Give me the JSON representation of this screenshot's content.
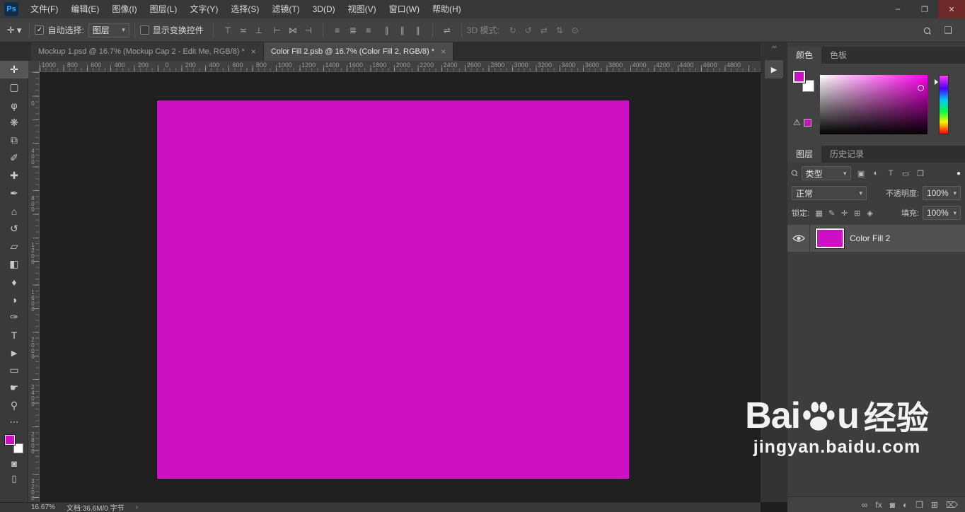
{
  "colors": {
    "accent": "#CB11C3",
    "hue": "#FF00EA"
  },
  "icons": {
    "ps-logo": "Ps",
    "minimize-window": "–",
    "restore-window": "❐",
    "close-window": "✕",
    "caret-down": "▾",
    "check": "✓",
    "search": "Ϙ",
    "tab-close": "×",
    "move-tool": "✛",
    "rectangular-marquee-tool": "▢",
    "lasso-tool": "φ",
    "quick-selection-tool": "❋",
    "crop-tool": "⧉",
    "eyedropper-tool": "✐",
    "spot-healing-brush-tool": "✚",
    "brush-tool": "✒",
    "clone-stamp-tool": "⌂",
    "history-brush-tool": "↺",
    "eraser-tool": "▱",
    "gradient-tool": "◧",
    "blur-tool": "♦",
    "dodge-tool": "◑",
    "pen-tool": "✑",
    "horizontal-type-tool": "T",
    "path-selection-tool": "►",
    "rectangle-tool": "▭",
    "hand-tool": "☛",
    "zoom-tool": "⚲",
    "edit-toolbar": "⋯",
    "quick-mask": "◙",
    "screen-mode": "▯",
    "align-top-edges": "⊤",
    "align-vertical-centers": "≍",
    "align-bottom-edges": "⊥",
    "align-left-edges": "⊢",
    "align-horizontal-centers": "⋈",
    "align-right-edges": "⊣",
    "distribute-top-edges": "≡",
    "distribute-vertical-centers": "≣",
    "distribute-bottom-edges": "≡",
    "distribute-left-edges": "∥",
    "distribute-horizontal-centers": "∥",
    "distribute-right-edges": "∥",
    "distribute-spacing": "⇌",
    "orbit-3d-camera": "↻",
    "roll-3d-camera": "↺",
    "pan-3d-camera": "⇄",
    "slide-3d-camera": "⇅",
    "zoom-3d-camera": "⊙",
    "workspace-switcher": "❏",
    "panel-collapse": "^^",
    "panel-expand": "▶",
    "gamut-warning": "⚠",
    "filter-pixel-layers": "▣",
    "filter-adjustment-layers": "◐",
    "filter-type-layers": "T",
    "filter-shape-layers": "▭",
    "filter-smart-objects": "❒",
    "filter-toggle": "●",
    "lock-transparent-pixels": "▦",
    "lock-image-pixels": "✎",
    "lock-position": "✛",
    "lock-artboard": "⊞",
    "lock-all": "◈",
    "link-layers": "∞",
    "layer-style": "fx",
    "add-layer-mask": "◙",
    "new-adjustment-layer": "◐",
    "new-group": "❒",
    "new-layer": "⊞",
    "delete-layer": "⌦",
    "status-expand": "›"
  },
  "menubar": {
    "items": [
      {
        "label": "文件(F)"
      },
      {
        "label": "编辑(E)"
      },
      {
        "label": "图像(I)"
      },
      {
        "label": "图层(L)"
      },
      {
        "label": "文字(Y)"
      },
      {
        "label": "选择(S)"
      },
      {
        "label": "滤镜(T)"
      },
      {
        "label": "3D(D)"
      },
      {
        "label": "视图(V)"
      },
      {
        "label": "窗口(W)"
      },
      {
        "label": "帮助(H)"
      }
    ]
  },
  "optionsbar": {
    "auto_select_label": "自动选择:",
    "auto_select_value": "图层",
    "show_transform_label": "显示变换控件",
    "mode_3d_label": "3D 模式:",
    "align_icons_1": [
      "align-top-edges",
      "align-vertical-centers",
      "align-bottom-edges"
    ],
    "align_icons_2": [
      "align-left-edges",
      "align-horizontal-centers",
      "align-right-edges"
    ],
    "distribute_icons_1": [
      "distribute-top-edges",
      "distribute-vertical-centers",
      "distribute-bottom-edges"
    ],
    "distribute_icons_2": [
      "distribute-left-edges",
      "distribute-horizontal-centers",
      "distribute-right-edges"
    ],
    "extra_icons": [
      "distribute-spacing"
    ],
    "mode_3d_icons": [
      "orbit-3d-camera",
      "roll-3d-camera",
      "pan-3d-camera",
      "slide-3d-camera",
      "zoom-3d-camera"
    ]
  },
  "tabs": [
    {
      "title": "Mockup 1.psd @ 16.7% (Mockup Cap 2 - Edit Me, RGB/8) *"
    },
    {
      "title": "Color Fill 2.psb @ 16.7% (Color Fill 2, RGB/8) *"
    }
  ],
  "toolbar": {
    "tools": [
      {
        "name": "move-tool",
        "selected": true
      },
      {
        "name": "rectangular-marquee-tool"
      },
      {
        "name": "lasso-tool"
      },
      {
        "name": "quick-selection-tool"
      },
      {
        "name": "crop-tool"
      },
      {
        "name": "eyedropper-tool"
      },
      {
        "name": "spot-healing-brush-tool"
      },
      {
        "name": "brush-tool"
      },
      {
        "name": "clone-stamp-tool"
      },
      {
        "name": "history-brush-tool"
      },
      {
        "name": "eraser-tool"
      },
      {
        "name": "gradient-tool"
      },
      {
        "name": "blur-tool"
      },
      {
        "name": "dodge-tool"
      },
      {
        "name": "pen-tool"
      },
      {
        "name": "horizontal-type-tool"
      },
      {
        "name": "path-selection-tool"
      },
      {
        "name": "rectangle-tool"
      },
      {
        "name": "hand-tool"
      },
      {
        "name": "zoom-tool"
      }
    ]
  },
  "ruler": {
    "horizontal": [
      "1000",
      "800",
      "600",
      "400",
      "200",
      "0",
      "200",
      "400",
      "600",
      "800",
      "1000",
      "1200",
      "1400",
      "1600",
      "1800",
      "2000",
      "2200",
      "2400",
      "2600",
      "2800",
      "3000",
      "3200",
      "3400",
      "3600",
      "3800",
      "4000",
      "4200",
      "4400",
      "4600",
      "4800"
    ],
    "vertical": [
      "0",
      "400",
      "800",
      "1200",
      "1600",
      "2000",
      "2400",
      "2800",
      "3200"
    ]
  },
  "panels": {
    "color": {
      "tab_color": "颜色",
      "tab_swatches": "色板"
    },
    "layers": {
      "tab_layers": "图层",
      "tab_history": "历史记录",
      "filter_label": "类型",
      "filter_icons": [
        "filter-pixel-layers",
        "filter-adjustment-layers",
        "filter-type-layers",
        "filter-shape-layers",
        "filter-smart-objects"
      ],
      "blend_mode": "正常",
      "opacity_label": "不透明度:",
      "opacity_value": "100%",
      "lock_label": "锁定:",
      "lock_icons": [
        "lock-transparent-pixels",
        "lock-image-pixels",
        "lock-position",
        "lock-artboard",
        "lock-all"
      ],
      "fill_label": "填充:",
      "fill_value": "100%",
      "rows": [
        {
          "name": "Color Fill 2"
        }
      ],
      "bottom_icons": [
        "link-layers",
        "layer-style",
        "add-layer-mask",
        "new-adjustment-layer",
        "new-group",
        "new-layer",
        "delete-layer"
      ]
    }
  },
  "statusbar": {
    "zoom": "16.67%",
    "doc_info": "文档:36.6M/0 字节"
  },
  "watermark": {
    "brand_prefix": "Bai",
    "brand_suffix": "u",
    "brand_cn": "经验",
    "url": "jingyan.baidu.com"
  }
}
